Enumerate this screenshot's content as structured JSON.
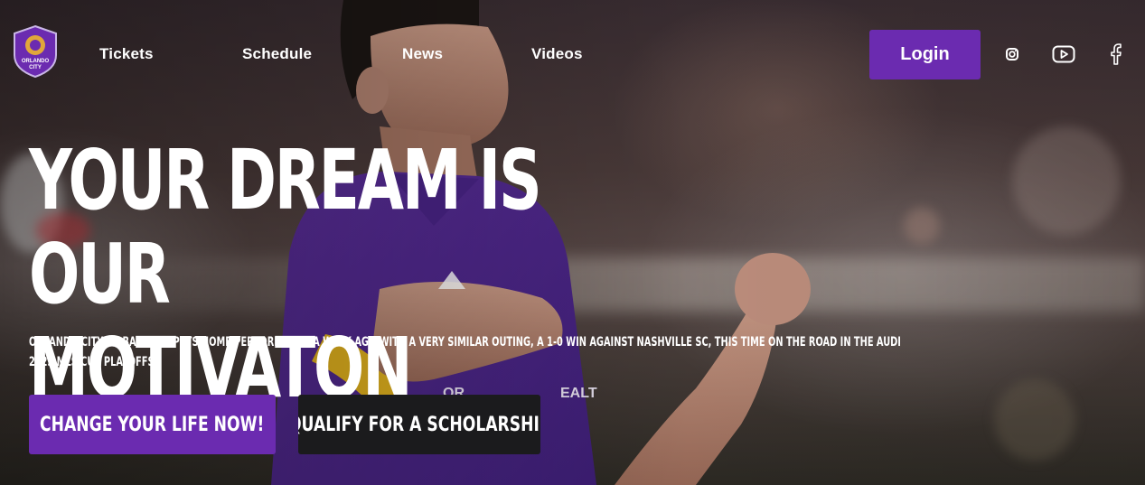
{
  "brand": {
    "logo_alt": "Orlando City",
    "logo_text_line1": "ORLANDO",
    "logo_text_line2": "CITY",
    "accent_color": "#6b2bb0",
    "dark_button_color": "#1b1b1d"
  },
  "nav": {
    "items": [
      {
        "label": "Tickets"
      },
      {
        "label": "Schedule"
      },
      {
        "label": "News"
      },
      {
        "label": "Videos"
      }
    ],
    "login_label": "Login",
    "social": [
      {
        "icon": "instagram-icon"
      },
      {
        "icon": "youtube-icon"
      },
      {
        "icon": "facebook-icon"
      }
    ]
  },
  "hero": {
    "headline_line1": "YOUR DREAM IS OUR",
    "headline_line2": "MOTIVATON",
    "subtext": "ORLANDO CITY SC BACKED UP ITS HOME PERFORMANCE A WEEK AGO WITH A VERY SIMILAR OUTING, A 1-0 WIN AGAINST NASHVILLE SC, THIS TIME ON THE ROAD IN THE AUDI 2023 MLS CUP PLAYOFFS.",
    "cta_primary": "CHANGE YOUR LIFE NOW!",
    "cta_secondary": "QUALIFY FOR A SCHOLARSHIP"
  }
}
